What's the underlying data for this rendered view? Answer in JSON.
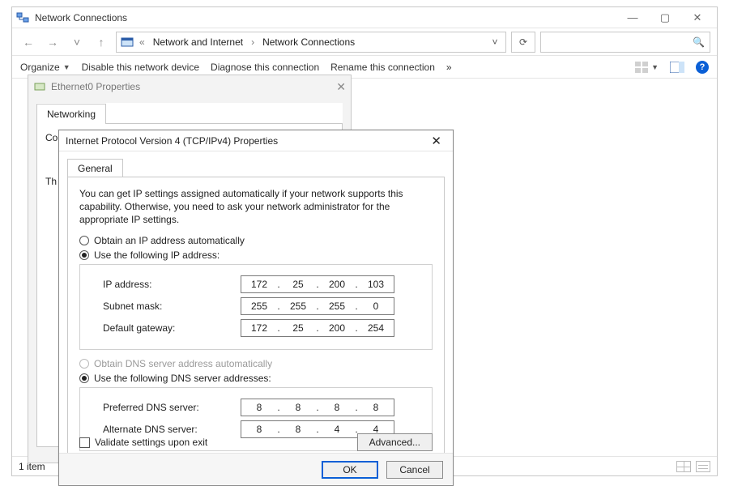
{
  "explorer": {
    "title": "Network Connections",
    "breadcrumb": {
      "prefix": "«",
      "seg1": "Network and Internet",
      "seg2": "Network Connections"
    },
    "nav": {
      "back_glyph": "←",
      "fwd_glyph": "→",
      "up_glyph": "↑",
      "drop_glyph": "˅",
      "history_glyph": "˅",
      "refresh_glyph": "⟳",
      "search_glyph": "🔍"
    },
    "toolbar": {
      "organize": "Organize",
      "disable": "Disable this network device",
      "diagnose": "Diagnose this connection",
      "rename": "Rename this connection",
      "more_glyph": "»"
    },
    "status": {
      "count": "1 item"
    },
    "winbtns": {
      "min": "—",
      "max": "▢",
      "close": "✕"
    }
  },
  "ethwin": {
    "title": "Ethernet0 Properties",
    "close_glyph": "✕",
    "tab": "Networking",
    "connect_label_prefix": "Co",
    "this_prefix": "Th"
  },
  "ipwin": {
    "title": "Internet Protocol Version 4 (TCP/IPv4) Properties",
    "close_glyph": "✕",
    "tab": "General",
    "description": "You can get IP settings assigned automatically if your network supports this capability. Otherwise, you need to ask your network administrator for the appropriate IP settings.",
    "opt_auto_ip": "Obtain an IP address automatically",
    "opt_static_ip": "Use the following IP address:",
    "lbl_ip": "IP address:",
    "lbl_mask": "Subnet mask:",
    "lbl_gw": "Default gateway:",
    "opt_auto_dns": "Obtain DNS server address automatically",
    "opt_static_dns": "Use the following DNS server addresses:",
    "lbl_dns1": "Preferred DNS server:",
    "lbl_dns2": "Alternate DNS server:",
    "validate": "Validate settings upon exit",
    "advanced": "Advanced...",
    "ok": "OK",
    "cancel": "Cancel",
    "values": {
      "ip": [
        "172",
        "25",
        "200",
        "103"
      ],
      "mask": [
        "255",
        "255",
        "255",
        "0"
      ],
      "gw": [
        "172",
        "25",
        "200",
        "254"
      ],
      "dns1": [
        "8",
        "8",
        "8",
        "8"
      ],
      "dns2": [
        "8",
        "8",
        "4",
        "4"
      ]
    }
  }
}
